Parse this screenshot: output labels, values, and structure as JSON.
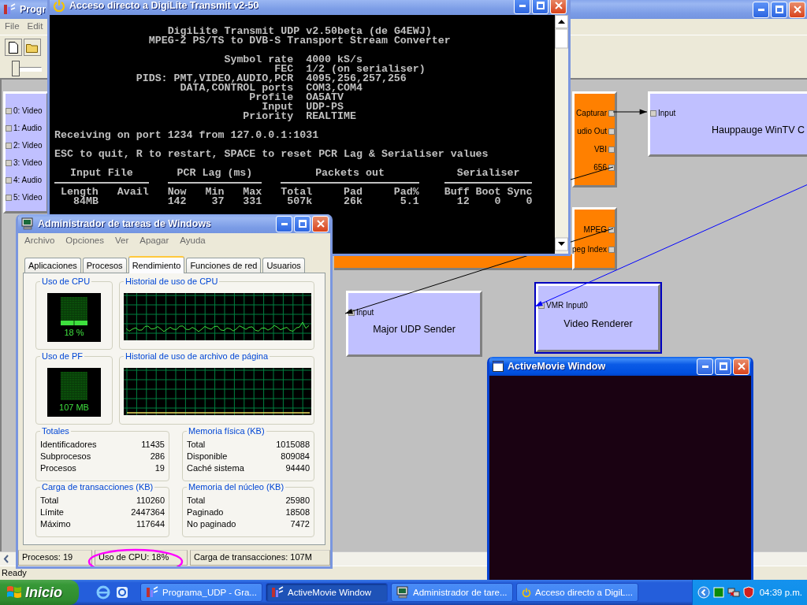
{
  "desktop_app": {
    "title": "Progr",
    "menu": [
      "File",
      "Edit"
    ],
    "slider": {
      "level": 0
    },
    "graph": {
      "nodes": [
        {
          "kind": "pin_list",
          "pins": [
            "0: Video",
            "1: Audio",
            "2: Video",
            "3: Video",
            "4: Audio",
            "5: Video"
          ]
        },
        {
          "kind": "source",
          "pins": [
            "Capturar",
            "udio Out",
            "VBI",
            "656"
          ]
        },
        {
          "kind": "source",
          "pins": [
            "MPEG",
            "peg Index"
          ]
        },
        {
          "kind": "filter",
          "title": "Hauppauge WinTV C",
          "pins": [
            "Input"
          ],
          "selected": false
        },
        {
          "kind": "filter",
          "title": "Major UDP Sender",
          "pins": [
            "Input"
          ],
          "selected": false
        },
        {
          "kind": "filter",
          "title": "Video Renderer",
          "pins": [
            "VMR Input0"
          ],
          "selected": true
        }
      ]
    },
    "status": "Ready"
  },
  "console_window": {
    "title": "Acceso directo a DigiLite Transmit v2-50",
    "banner": [
      "DigiLite Transmit UDP v2.50beta (de G4EWJ)",
      "MPEG-2 PS/TS to DVB-S Transport Stream Converter"
    ],
    "settings": [
      {
        "label": "Symbol rate",
        "value": "4000 kS/s"
      },
      {
        "label": "FEC",
        "value": "1/2 (on serialiser)"
      },
      {
        "label": "PIDS: PMT,VIDEO,AUDIO,PCR",
        "value": "4095,256,257,256"
      },
      {
        "label": "DATA,CONTROL ports",
        "value": "COM3,COM4"
      },
      {
        "label": "Profile",
        "value": "OA5ATV"
      },
      {
        "label": "Input",
        "value": "UDP-PS"
      },
      {
        "label": "Priority",
        "value": "REALTIME"
      }
    ],
    "messages": [
      "Receiving on port 1234 from 127.0.0.1:1031",
      "ESC to quit, R to restart, SPACE to reset PCR Lag & Serialiser values"
    ],
    "stats": [
      {
        "title": "Input File",
        "columns": [
          {
            "head": "Length",
            "value": "84MB"
          },
          {
            "head": "Avail"
          }
        ]
      },
      {
        "title": "PCR Lag (ms)",
        "columns": [
          {
            "head": "Now",
            "value": "142"
          },
          {
            "head": "Min",
            "value": "37"
          },
          {
            "head": "Max",
            "value": "331"
          }
        ]
      },
      {
        "title": "Packets out",
        "columns": [
          {
            "head": "Total",
            "value": "507k"
          },
          {
            "head": "Pad",
            "value": "26k"
          },
          {
            "head": "Pad%",
            "value": "5.1"
          }
        ]
      },
      {
        "title": "Serialiser",
        "columns": [
          {
            "head": "Buff",
            "value": "12"
          },
          {
            "head": "Boot",
            "value": "0"
          },
          {
            "head": "Sync",
            "value": "0"
          }
        ]
      }
    ]
  },
  "task_manager": {
    "title": "Administrador de tareas de Windows",
    "menu": [
      "Archivo",
      "Opciones",
      "Ver",
      "Apagar",
      "Ayuda"
    ],
    "tabs": [
      {
        "label": "Aplicaciones",
        "selected": false
      },
      {
        "label": "Procesos",
        "selected": false
      },
      {
        "label": "Rendimiento",
        "selected": true
      },
      {
        "label": "Funciones de red",
        "selected": false
      },
      {
        "label": "Usuarios",
        "selected": false
      }
    ],
    "cpu_usage": {
      "title": "Uso de CPU",
      "reading": "18 %",
      "level": 0.18
    },
    "cpu_history": {
      "title": "Historial de uso de CPU"
    },
    "pf_usage": {
      "title": "Uso de PF",
      "reading": "107 MB"
    },
    "pf_history": {
      "title": "Historial de uso de archivo de página"
    },
    "groups": [
      {
        "title": "Totales",
        "rows": [
          {
            "label": "Identificadores",
            "value": "11435"
          },
          {
            "label": "Subprocesos",
            "value": "286"
          },
          {
            "label": "Procesos",
            "value": "19"
          }
        ]
      },
      {
        "title": "Memoria física (KB)",
        "rows": [
          {
            "label": "Total",
            "value": "1015088"
          },
          {
            "label": "Disponible",
            "value": "809084"
          },
          {
            "label": "Caché sistema",
            "value": "94440"
          }
        ]
      },
      {
        "title": "Carga de transacciones (KB)",
        "rows": [
          {
            "label": "Total",
            "value": "110260"
          },
          {
            "label": "Límite",
            "value": "2447364"
          },
          {
            "label": "Máximo",
            "value": "117644"
          }
        ]
      },
      {
        "title": "Memoria del núcleo (KB)",
        "rows": [
          {
            "label": "Total",
            "value": "25980"
          },
          {
            "label": "Paginado",
            "value": "18508"
          },
          {
            "label": "No paginado",
            "value": "7472"
          }
        ]
      }
    ],
    "status_bar": [
      {
        "text": "Procesos: 19",
        "highlighted": false
      },
      {
        "text": "Uso de CPU: 18%",
        "highlighted": true
      },
      {
        "text": "Carga de transacciones: 107M",
        "highlighted": false
      }
    ]
  },
  "activemovie_window": {
    "title": "ActiveMovie Window"
  },
  "taskbar": {
    "start": "Inicio",
    "tasks": [
      {
        "label": "Programa_UDP - Gra...",
        "selected": false
      },
      {
        "label": "ActiveMovie Window",
        "selected": true
      },
      {
        "label": "Administrador de tare...",
        "selected": false
      },
      {
        "label": "Acceso directo a DigiL...",
        "selected": false
      }
    ],
    "clock": "04:39 p.m."
  }
}
